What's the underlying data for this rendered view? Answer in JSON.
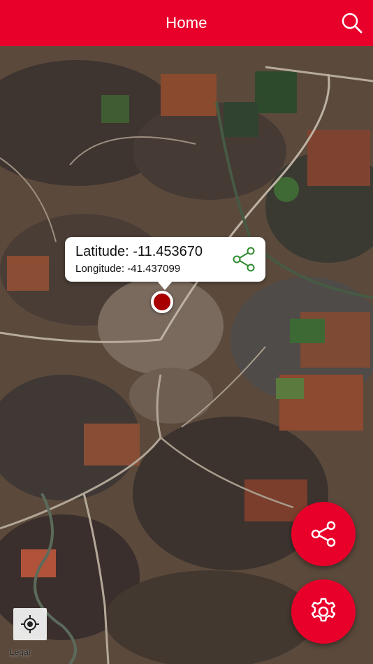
{
  "navbar": {
    "title": "Home",
    "search_icon": "search-icon",
    "background": "#e8002a"
  },
  "callout": {
    "latitude": "Latitude: -11.453670",
    "longitude": "Longitude: -41.437099",
    "share_icon": "share-icon",
    "share_color": "#2e8b2e"
  },
  "pin": {
    "color": "#a80000"
  },
  "buttons": {
    "share_fab_icon": "share-icon",
    "settings_fab_icon": "gear-icon",
    "locate_icon": "crosshair-icon"
  },
  "map": {
    "type": "satellite",
    "legal_label": "Legal"
  }
}
